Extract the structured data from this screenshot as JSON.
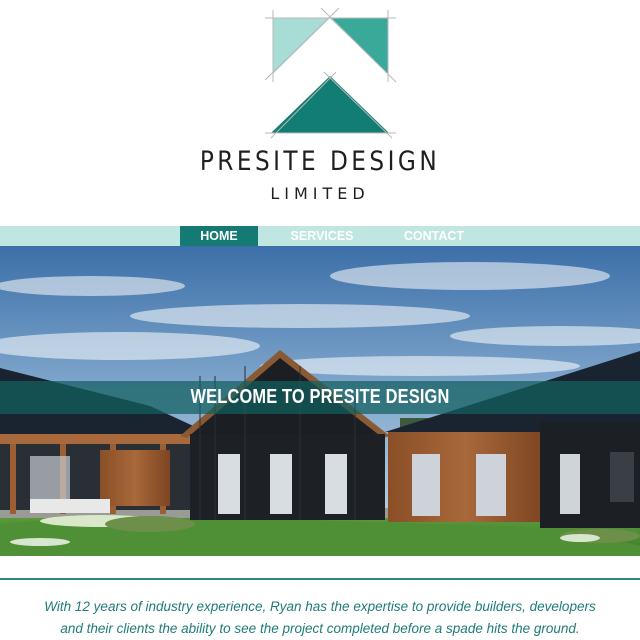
{
  "brand": {
    "name": "PRESITE DESIGN",
    "suffix": "LIMITED"
  },
  "nav": {
    "items": [
      {
        "label": "HOME",
        "active": true
      },
      {
        "label": "SERVICES",
        "active": false
      },
      {
        "label": "CONTACT",
        "active": false
      }
    ]
  },
  "hero": {
    "banner_text": "WELCOME TO PRESITE DESIGN"
  },
  "intro": {
    "text": "With 12 years of industry experience, Ryan has the expertise to provide builders, developers and their clients the ability to see the project completed before a spade hits the ground."
  },
  "colors": {
    "accent": "#167a74",
    "nav_bg": "#c0e6e1",
    "logo_light": "#a8ddd6",
    "logo_mid": "#3aa99a",
    "logo_dark": "#127d73"
  }
}
